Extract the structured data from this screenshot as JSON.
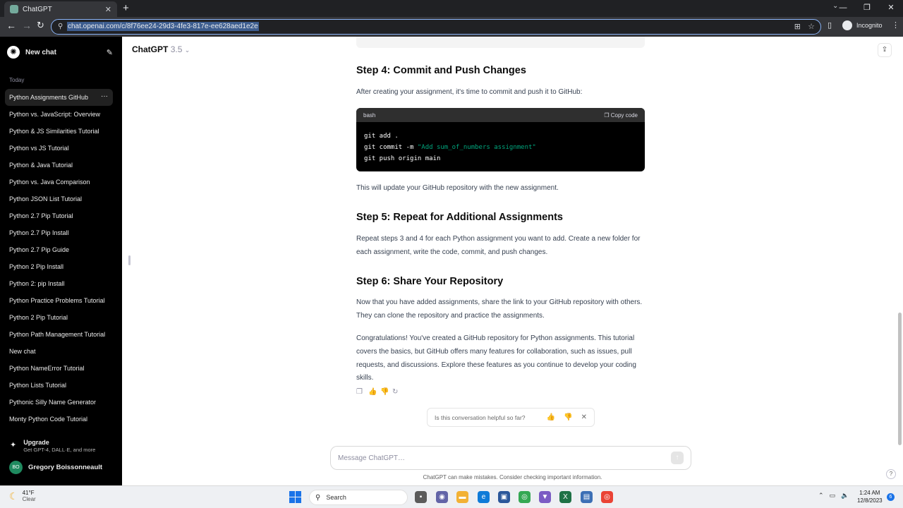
{
  "browser": {
    "tab_title": "ChatGPT",
    "url": "chat.openai.com/c/8f76ee24-29d3-4fe3-817e-ee628aed1e2e",
    "incognito_label": "Incognito"
  },
  "sidebar": {
    "new_chat": "New chat",
    "section_today": "Today",
    "history": [
      "Python Assignments GitHub",
      "Python vs. JavaScript: Overview",
      "Python & JS Similarities Tutorial",
      "Python vs JS Tutorial",
      "Python & Java Tutorial",
      "Python vs. Java Comparison",
      "Python JSON List Tutorial",
      "Python 2.7 Pip Tutorial",
      "Python 2.7 Pip Install",
      "Python 2.7 Pip Guide",
      "Python 2 Pip Install",
      "Python 2: pip Install",
      "Python Practice Problems Tutorial",
      "Python 2 Pip Tutorial",
      "Python Path Management Tutorial",
      "New chat",
      "Python NameError Tutorial",
      "Python Lists Tutorial",
      "Pythonic Silly Name Generator",
      "Monty Python Code Tutorial"
    ],
    "upgrade_title": "Upgrade",
    "upgrade_sub": "Get GPT-4, DALL·E, and more",
    "user_initials": "BO",
    "user_name": "Gregory Boissonneault"
  },
  "header": {
    "model": "ChatGPT",
    "version": "3.5"
  },
  "content": {
    "step4_title": "Step 4: Commit and Push Changes",
    "step4_text": "After creating your assignment, it's time to commit and push it to GitHub:",
    "code": {
      "lang": "bash",
      "copy_label": "Copy code",
      "line1": "git add .",
      "line2_cmd": "git commit -m ",
      "line2_str": "\"Add sum_of_numbers assignment\"",
      "line3": "git push origin main"
    },
    "step4_after": "This will update your GitHub repository with the new assignment.",
    "step5_title": "Step 5: Repeat for Additional Assignments",
    "step5_text": "Repeat steps 3 and 4 for each Python assignment you want to add. Create a new folder for each assignment, write the code, commit, and push changes.",
    "step6_title": "Step 6: Share Your Repository",
    "step6_text": "Now that you have added assignments, share the link to your GitHub repository with others. They can clone the repository and practice the assignments.",
    "closing": "Congratulations! You've created a GitHub repository for Python assignments. This tutorial covers the basics, but GitHub offers many features for collaboration, such as issues, pull requests, and discussions. Explore these features as you continue to develop your coding skills."
  },
  "feedback": {
    "question": "Is this conversation helpful so far?"
  },
  "composer": {
    "placeholder": "Message ChatGPT…",
    "disclaimer": "ChatGPT can make mistakes. Consider checking important information."
  },
  "taskbar": {
    "temp": "41°F",
    "condition": "Clear",
    "search_label": "Search",
    "time": "1:24 AM",
    "date": "12/8/2023",
    "notifications": "6"
  }
}
